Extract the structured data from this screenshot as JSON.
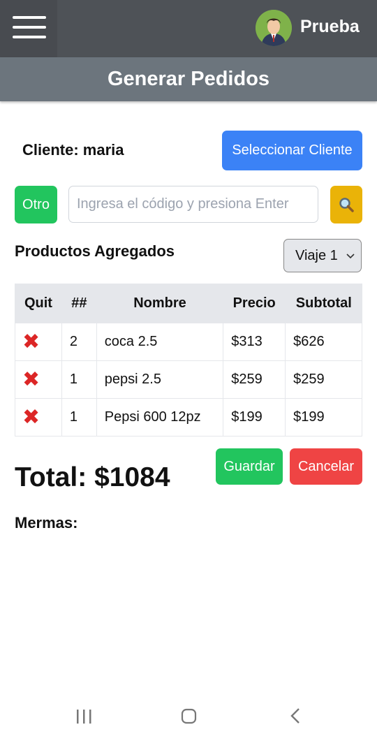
{
  "header": {
    "user_name": "Prueba",
    "menu_icon": "hamburger-menu-icon",
    "avatar_icon": "user-avatar"
  },
  "page": {
    "title": "Generar Pedidos"
  },
  "client": {
    "label": "Cliente: maria",
    "select_button": "Seleccionar Cliente"
  },
  "code_entry": {
    "other_button": "Otro",
    "placeholder": "Ingresa el código y presiona Enter",
    "value": "",
    "search_icon": "search-icon"
  },
  "products": {
    "title": "Productos Agregados",
    "trip_selected": "Viaje 1",
    "columns": [
      "Quit",
      "##",
      "Nombre",
      "Precio",
      "Subtotal"
    ],
    "rows": [
      {
        "quantity": "2",
        "name": "coca 2.5",
        "price": "$313",
        "subtotal": "$626"
      },
      {
        "quantity": "1",
        "name": "pepsi 2.5",
        "price": "$259",
        "subtotal": "$259"
      },
      {
        "quantity": "1",
        "name": "Pepsi 600 12pz",
        "price": "$199",
        "subtotal": "$199"
      }
    ],
    "remove_icon": "✖"
  },
  "footer": {
    "total": "Total: $1084",
    "save_button": "Guardar",
    "cancel_button": "Cancelar",
    "mermas_label": "Mermas:"
  },
  "colors": {
    "topbar": "#4e5257",
    "titlebar": "#6c757d",
    "primary": "#3b82f6",
    "success": "#22c55e",
    "danger": "#ef4444",
    "warning": "#eab308"
  }
}
